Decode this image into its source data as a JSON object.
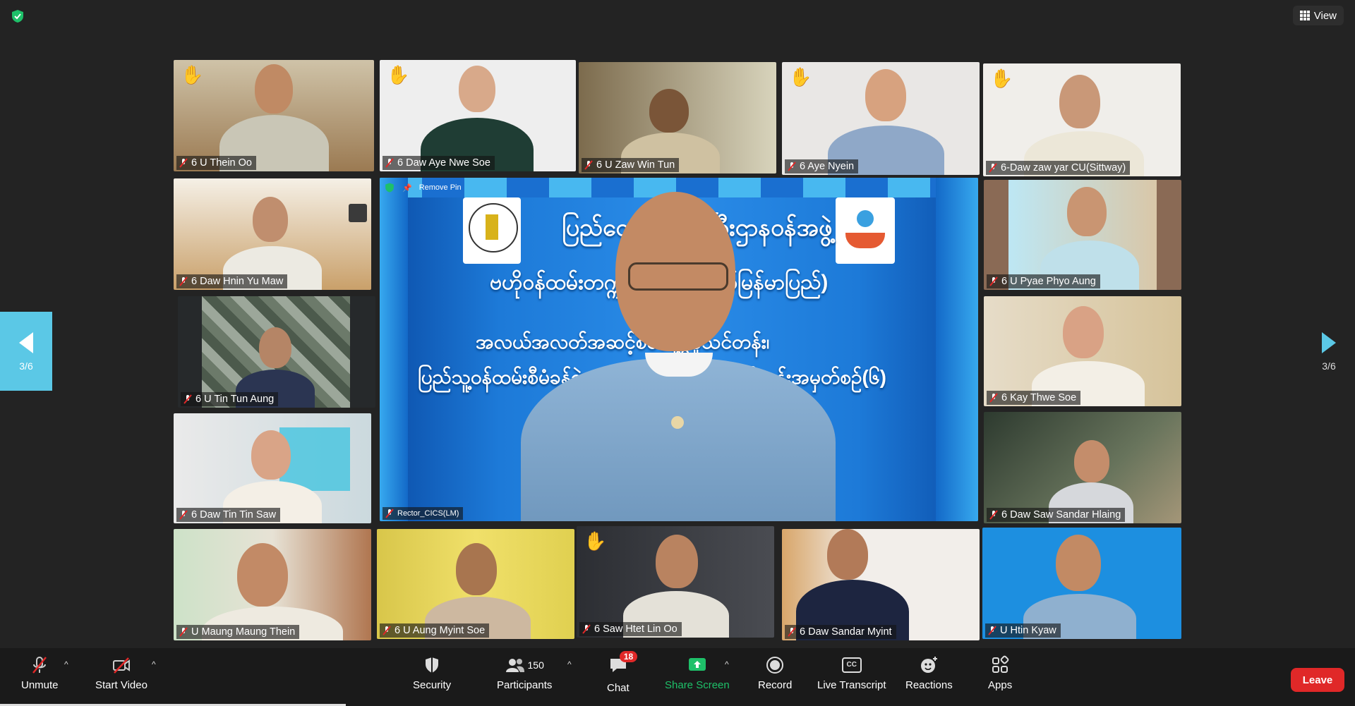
{
  "header": {
    "view_label": "View"
  },
  "pager": {
    "left_label": "3/6",
    "right_label": "3/6"
  },
  "featured": {
    "name": "Rector_CICS(LM)",
    "pin_label": "Remove Pin",
    "banner_line1": "ပြည်ထောင်စုဝန်ကြီးဌာနဝန်အဖွဲ့",
    "banner_line2": "ဗဟိုဝန်ထမ်းတက္ကသိုလ် (အောက်မြန်မာပြည်)",
    "banner_line3": "အလယ်အလတ်အဆင့်စီမံခန့်ခွဲမှုသင်တန်း၊",
    "banner_line4": "ပြည်သူ့ဝန်ထမ်းစီမံခန့်ခွဲမှုအဆင့်မြင့်ဒီပလိုမာသင်တန်းအမှတ်စဉ်(၆)"
  },
  "participants": [
    {
      "name": "6 U Thein Oo",
      "hand": true
    },
    {
      "name": "6 Daw Aye Nwe Soe",
      "hand": true
    },
    {
      "name": "6 U Zaw Win Tun",
      "hand": false
    },
    {
      "name": "6 Aye Nyein",
      "hand": true
    },
    {
      "name": "6-Daw zaw yar  CU(Sittway)",
      "hand": true
    },
    {
      "name": "6 Daw Hnin Yu Maw",
      "hand": false
    },
    {
      "name": "6  U Pyae Phyo Aung",
      "hand": false
    },
    {
      "name": "6 U Tin Tun Aung",
      "hand": false
    },
    {
      "name": "6  Kay Thwe Soe",
      "hand": false
    },
    {
      "name": "6 Daw Tin Tin Saw",
      "hand": false
    },
    {
      "name": "6 Daw Saw Sandar Hlaing",
      "hand": false
    },
    {
      "name": "U Maung Maung Thein",
      "hand": false
    },
    {
      "name": "6 U Aung Myint Soe",
      "hand": false
    },
    {
      "name": "6 Saw Htet Lin Oo",
      "hand": true
    },
    {
      "name": "6 Daw Sandar Myint",
      "hand": false
    },
    {
      "name": "U Htin Kyaw",
      "hand": false
    }
  ],
  "toolbar": {
    "unmute": "Unmute",
    "start_video": "Start Video",
    "security": "Security",
    "participants": "Participants",
    "participants_count": "150",
    "chat": "Chat",
    "chat_badge": "18",
    "share_screen": "Share Screen",
    "record": "Record",
    "live_transcript": "Live Transcript",
    "cc_label": "CC",
    "reactions": "Reactions",
    "apps": "Apps",
    "leave": "Leave"
  },
  "colors": {
    "accent_green": "#1ec069",
    "leave_red": "#e02828",
    "pager_blue": "#5bc8e6",
    "banner_blue": "#1466c8"
  }
}
